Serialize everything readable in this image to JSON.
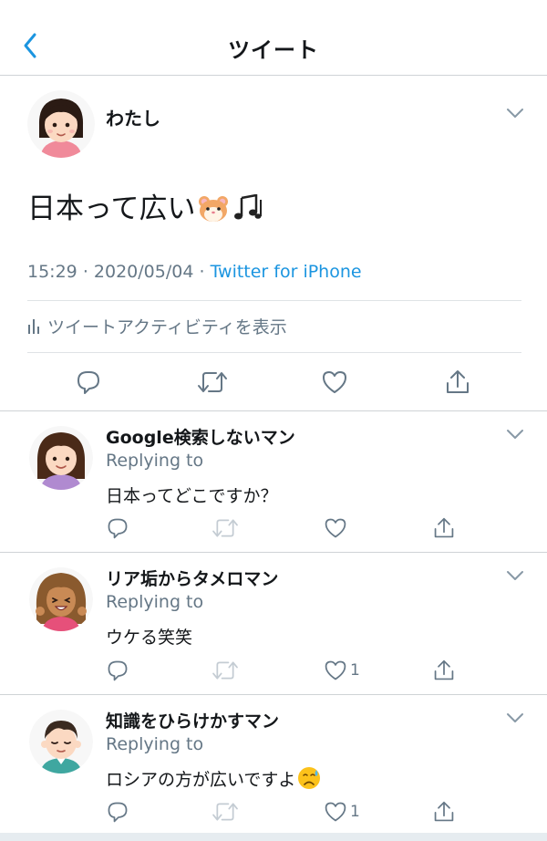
{
  "header": {
    "title": "ツイート",
    "back_icon": "chevron-left-icon"
  },
  "colors": {
    "accent": "#1b95e0",
    "muted": "#657786",
    "text": "#14171a",
    "divider": "#cfd3d6"
  },
  "main_tweet": {
    "author": "わたし",
    "text": "日本って広い",
    "emojis": [
      "hamster-face-icon",
      "music-notes-icon"
    ],
    "time": "15:29",
    "date": "2020/05/04",
    "separator": "·",
    "source": "Twitter for iPhone",
    "activity_label": "ツイートアクティビティを表示",
    "actions": [
      "reply-icon",
      "retweet-icon",
      "like-icon",
      "share-icon"
    ]
  },
  "replies": [
    {
      "author": "Google検索しないマン",
      "replying": "Replying to",
      "text": "日本ってどこですか？",
      "like_count": ""
    },
    {
      "author": "リア垢からタメロマン",
      "replying": "Replying to",
      "text": "ウケる笑笑",
      "like_count": "1"
    },
    {
      "author": "知識をひらけかすマン",
      "replying": "Replying to",
      "text": "ロシアの方が広いですよ",
      "emoji": "sad-relieved-face-icon",
      "like_count": "1"
    }
  ]
}
